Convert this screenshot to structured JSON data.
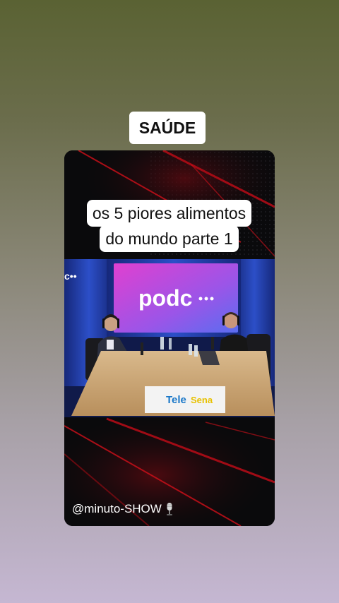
{
  "category": "SAÚDE",
  "title_lines": [
    "os 5 piores alimentos",
    "do mundo parte 1"
  ],
  "video": {
    "screen_logo": "podc",
    "sponsor_line1": "Tele",
    "sponsor_line2": "Sena"
  },
  "channel_handle": "@minuto-SHOW",
  "colors": {
    "accent_red": "#d0101a",
    "screen_magenta": "#e040d0",
    "screen_blue": "#5a6df0",
    "curtain_blue": "#1f3aa8"
  }
}
